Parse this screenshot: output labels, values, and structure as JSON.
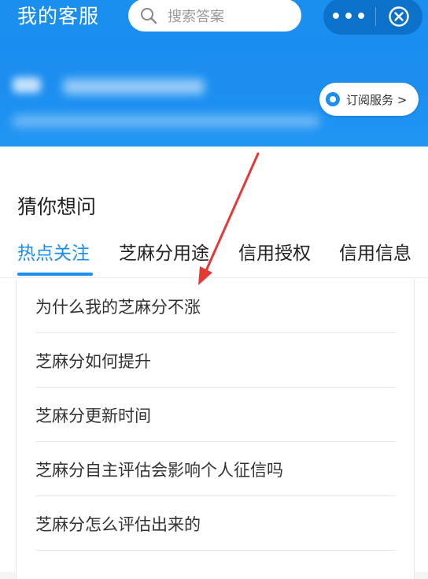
{
  "header": {
    "title": "我的客服",
    "search_placeholder": "搜索答案",
    "more_icon": "more-dots-icon",
    "close_icon": "close-circle-icon",
    "subscribe_label": "订阅服务 >"
  },
  "section": {
    "title": "猜你想问"
  },
  "tabs": [
    {
      "label": "热点关注",
      "active": true
    },
    {
      "label": "芝麻分用途",
      "active": false
    },
    {
      "label": "信用授权",
      "active": false
    },
    {
      "label": "信用信息",
      "active": false
    }
  ],
  "questions": [
    {
      "text": "为什么我的芝麻分不涨"
    },
    {
      "text": "芝麻分如何提升"
    },
    {
      "text": "芝麻分更新时间"
    },
    {
      "text": "芝麻分自主评估会影响个人征信吗"
    },
    {
      "text": "芝麻分怎么评估出来的"
    }
  ],
  "colors": {
    "brand_blue": "#1b8ef0",
    "annotation_arrow": "#e53935"
  }
}
